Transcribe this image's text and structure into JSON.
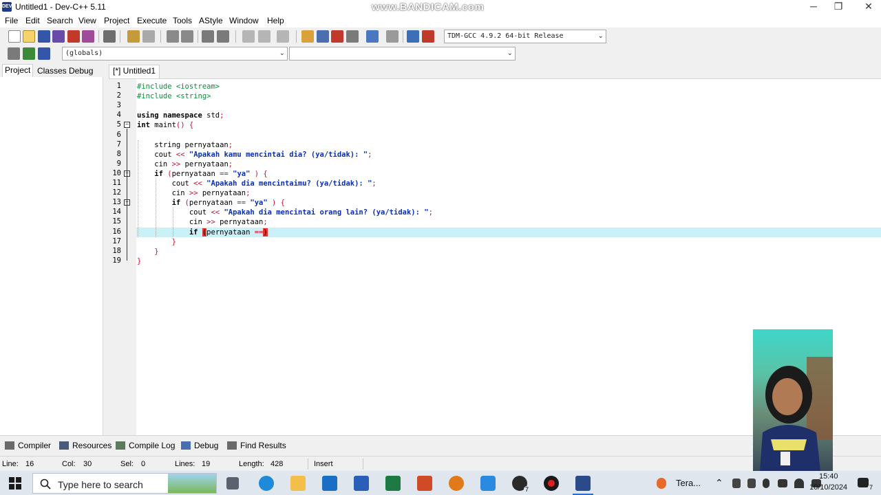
{
  "window": {
    "title": "Untitled1 - Dev-C++ 5.11",
    "watermark": "www.BANDICAM.com",
    "minimize": "─",
    "restore": "❐",
    "close": "✕"
  },
  "menu": [
    "File",
    "Edit",
    "Search",
    "View",
    "Project",
    "Execute",
    "Tools",
    "AStyle",
    "Window",
    "Help"
  ],
  "toolbar": {
    "compiler_select": "TDM-GCC 4.9.2 64-bit Release",
    "scope_select": "(globals)",
    "member_select": ""
  },
  "left_panel": {
    "tabs": [
      "Project",
      "Classes",
      "Debug"
    ],
    "active_tab": "Project"
  },
  "editor": {
    "tab_label": "[*] Untitled1",
    "line_numbers": [
      "1",
      "2",
      "3",
      "4",
      "5",
      "6",
      "7",
      "8",
      "9",
      "10",
      "11",
      "12",
      "13",
      "14",
      "15",
      "16",
      "17",
      "18",
      "19"
    ],
    "lines": [
      [
        {
          "c": "pp",
          "t": "#include <iostream>"
        }
      ],
      [
        {
          "c": "pp",
          "t": "#include <string>"
        }
      ],
      [],
      [
        {
          "c": "kw",
          "t": "using namespace"
        },
        {
          "c": "tx",
          "t": " std"
        },
        {
          "c": "op",
          "t": ";"
        }
      ],
      [
        {
          "c": "kw",
          "t": "int"
        },
        {
          "c": "tx",
          "t": " maint"
        },
        {
          "c": "op",
          "t": "() {"
        }
      ],
      [],
      [
        {
          "c": "tx",
          "t": "    string pernyataan"
        },
        {
          "c": "op",
          "t": ";"
        }
      ],
      [
        {
          "c": "tx",
          "t": "    cout "
        },
        {
          "c": "op",
          "t": "<<"
        },
        {
          "c": "tx",
          "t": " "
        },
        {
          "c": "str",
          "t": "\"Apakah kamu mencintai dia? (ya/tidak): \""
        },
        {
          "c": "op",
          "t": ";"
        }
      ],
      [
        {
          "c": "tx",
          "t": "    cin "
        },
        {
          "c": "op",
          "t": ">>"
        },
        {
          "c": "tx",
          "t": " pernyataan"
        },
        {
          "c": "op",
          "t": ";"
        }
      ],
      [
        {
          "c": "kw",
          "t": "    if"
        },
        {
          "c": "tx",
          "t": " "
        },
        {
          "c": "op",
          "t": "("
        },
        {
          "c": "tx",
          "t": "pernyataan "
        },
        {
          "c": "op",
          "t": "=="
        },
        {
          "c": "tx",
          "t": " "
        },
        {
          "c": "str",
          "t": "\"ya\""
        },
        {
          "c": "tx",
          "t": " "
        },
        {
          "c": "op",
          "t": ") {"
        }
      ],
      [
        {
          "c": "tx",
          "t": "        cout "
        },
        {
          "c": "op",
          "t": "<<"
        },
        {
          "c": "tx",
          "t": " "
        },
        {
          "c": "str",
          "t": "\"Apakah dia mencintaimu? (ya/tidak): \""
        },
        {
          "c": "op",
          "t": ";"
        }
      ],
      [
        {
          "c": "tx",
          "t": "        cin "
        },
        {
          "c": "op",
          "t": ">>"
        },
        {
          "c": "tx",
          "t": " pernyataan"
        },
        {
          "c": "op",
          "t": ";"
        }
      ],
      [
        {
          "c": "kw",
          "t": "        if"
        },
        {
          "c": "tx",
          "t": " "
        },
        {
          "c": "op",
          "t": "("
        },
        {
          "c": "tx",
          "t": "pernyataan "
        },
        {
          "c": "op",
          "t": "=="
        },
        {
          "c": "tx",
          "t": " "
        },
        {
          "c": "str",
          "t": "\"ya\""
        },
        {
          "c": "tx",
          "t": " "
        },
        {
          "c": "op",
          "t": ") {"
        }
      ],
      [
        {
          "c": "tx",
          "t": "            cout "
        },
        {
          "c": "op",
          "t": "<<"
        },
        {
          "c": "tx",
          "t": " "
        },
        {
          "c": "str",
          "t": "\"Apakah dia mencintai orang lain? (ya/tidak): \""
        },
        {
          "c": "op",
          "t": ";"
        }
      ],
      [
        {
          "c": "tx",
          "t": "            cin "
        },
        {
          "c": "op",
          "t": ">>"
        },
        {
          "c": "tx",
          "t": " pernyataan"
        },
        {
          "c": "op",
          "t": ";"
        }
      ],
      [
        {
          "c": "kw",
          "t": "            if"
        },
        {
          "c": "tx",
          "t": " "
        },
        {
          "c": "hi",
          "t": "("
        },
        {
          "c": "tx",
          "t": "pernyataan "
        },
        {
          "c": "op",
          "t": "=="
        },
        {
          "c": "hi",
          "t": ")"
        }
      ],
      [
        {
          "c": "op",
          "t": "        }"
        }
      ],
      [
        {
          "c": "op",
          "t": "    }"
        }
      ],
      [
        {
          "c": "op",
          "t": "}"
        }
      ]
    ],
    "current_line": 16
  },
  "bottom_tabs": [
    "Compiler",
    "Resources",
    "Compile Log",
    "Debug",
    "Find Results"
  ],
  "status": {
    "line_label": "Line:",
    "line": "16",
    "col_label": "Col:",
    "col": "30",
    "sel_label": "Sel:",
    "sel": "0",
    "lines_label": "Lines:",
    "lines": "19",
    "length_label": "Length:",
    "length": "428",
    "mode": "Insert"
  },
  "taskbar": {
    "search_placeholder": "Type here to search",
    "weather": "Tera...",
    "time": "15:40",
    "date": "10/10/2024",
    "notifications": "7",
    "whatsapp_badge": "7"
  }
}
